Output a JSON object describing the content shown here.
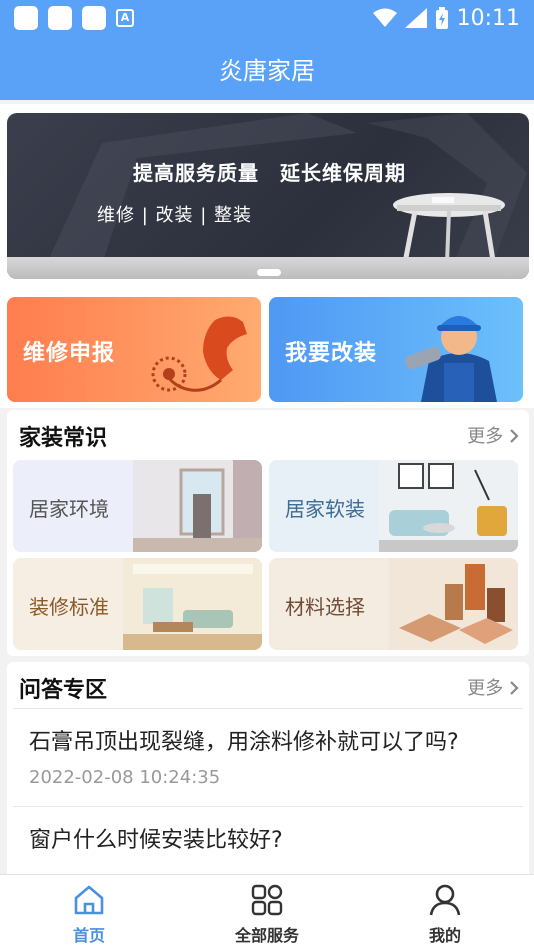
{
  "status": {
    "time": "10:11",
    "left_icons": [
      "app-square-icon",
      "app-square-icon",
      "app-square-icon",
      "a-icon"
    ],
    "right_icons": [
      "wifi-icon",
      "signal-icon",
      "battery-icon"
    ]
  },
  "header": {
    "title": "炎唐家居"
  },
  "banner": {
    "title": "提高服务质量　延长维保周期",
    "subtitle": "维修 | 改装 | 整装"
  },
  "services": [
    {
      "label": "维修申报",
      "icon": "telephone-icon",
      "color": "#ff8a55"
    },
    {
      "label": "我要改装",
      "icon": "worker-icon",
      "color": "#5aa2f8"
    }
  ],
  "home_knowledge": {
    "title": "家装常识",
    "more": "更多",
    "tiles": [
      {
        "label": "居家环境"
      },
      {
        "label": "居家软装"
      },
      {
        "label": "装修标准"
      },
      {
        "label": "材料选择"
      }
    ]
  },
  "qa": {
    "title": "问答专区",
    "more": "更多",
    "items": [
      {
        "question": "石膏吊顶出现裂缝，用涂料修补就可以了吗?",
        "time": "2022-02-08 10:24:35"
      },
      {
        "question": "窗户什么时候安装比较好?"
      }
    ]
  },
  "tabs": [
    {
      "label": "首页",
      "icon": "home-icon",
      "active": true
    },
    {
      "label": "全部服务",
      "icon": "grid-icon",
      "active": false
    },
    {
      "label": "我的",
      "icon": "user-icon",
      "active": false
    }
  ],
  "colors": {
    "primary": "#5aa2f8",
    "accent_orange": "#ff8a55",
    "tab_active": "#4a90e2"
  }
}
